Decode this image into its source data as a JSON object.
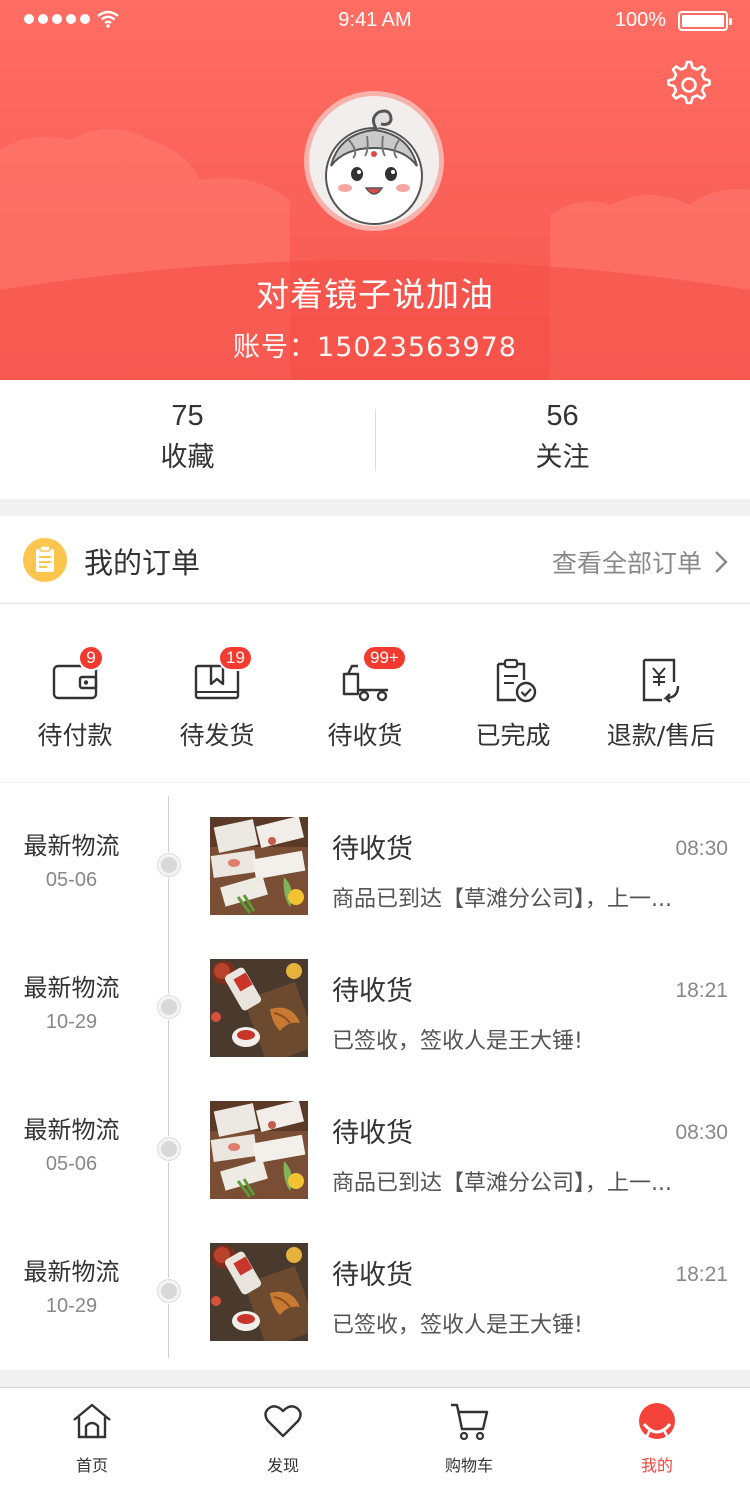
{
  "status_bar": {
    "time": "9:41 AM",
    "battery": "100%"
  },
  "profile": {
    "username": "对着镜子说加油",
    "account": "账号：15023563978",
    "avatar_icon": "cartoon-baby-avatar"
  },
  "stats": [
    {
      "value": "75",
      "label": "收藏"
    },
    {
      "value": "56",
      "label": "关注"
    }
  ],
  "orders": {
    "title": "我的订单",
    "view_all": "查看全部订单",
    "items": [
      {
        "label": "待付款",
        "badge": "9",
        "icon": "wallet-icon"
      },
      {
        "label": "待发货",
        "badge": "19",
        "icon": "package-icon"
      },
      {
        "label": "待收货",
        "badge": "99+",
        "icon": "truck-icon"
      },
      {
        "label": "已完成",
        "badge": "",
        "icon": "clipboard-check-icon"
      },
      {
        "label": "退款/售后",
        "badge": "",
        "icon": "refund-icon"
      }
    ]
  },
  "logistics": [
    {
      "title": "最新物流",
      "date": "05-06",
      "status": "待收货",
      "time": "08:30",
      "desc": "商品已到达【草滩分公司】，上一...",
      "thumb": "cosmetics"
    },
    {
      "title": "最新物流",
      "date": "10-29",
      "status": "待收货",
      "time": "18:21",
      "desc": "已签收，签收人是王大锤!",
      "thumb": "snacks"
    },
    {
      "title": "最新物流",
      "date": "05-06",
      "status": "待收货",
      "time": "08:30",
      "desc": "商品已到达【草滩分公司】，上一...",
      "thumb": "cosmetics"
    },
    {
      "title": "最新物流",
      "date": "10-29",
      "status": "待收货",
      "time": "18:21",
      "desc": "已签收，签收人是王大锤!",
      "thumb": "snacks"
    }
  ],
  "tabbar": [
    {
      "label": "首页",
      "icon": "home-icon",
      "active": false
    },
    {
      "label": "发现",
      "icon": "heart-icon",
      "active": false
    },
    {
      "label": "购物车",
      "icon": "cart-icon",
      "active": false
    },
    {
      "label": "我的",
      "icon": "profile-icon",
      "active": true
    }
  ],
  "colors": {
    "brand": "#f6574f",
    "badge": "#f23a2f",
    "order_icon": "#fcc54d"
  }
}
